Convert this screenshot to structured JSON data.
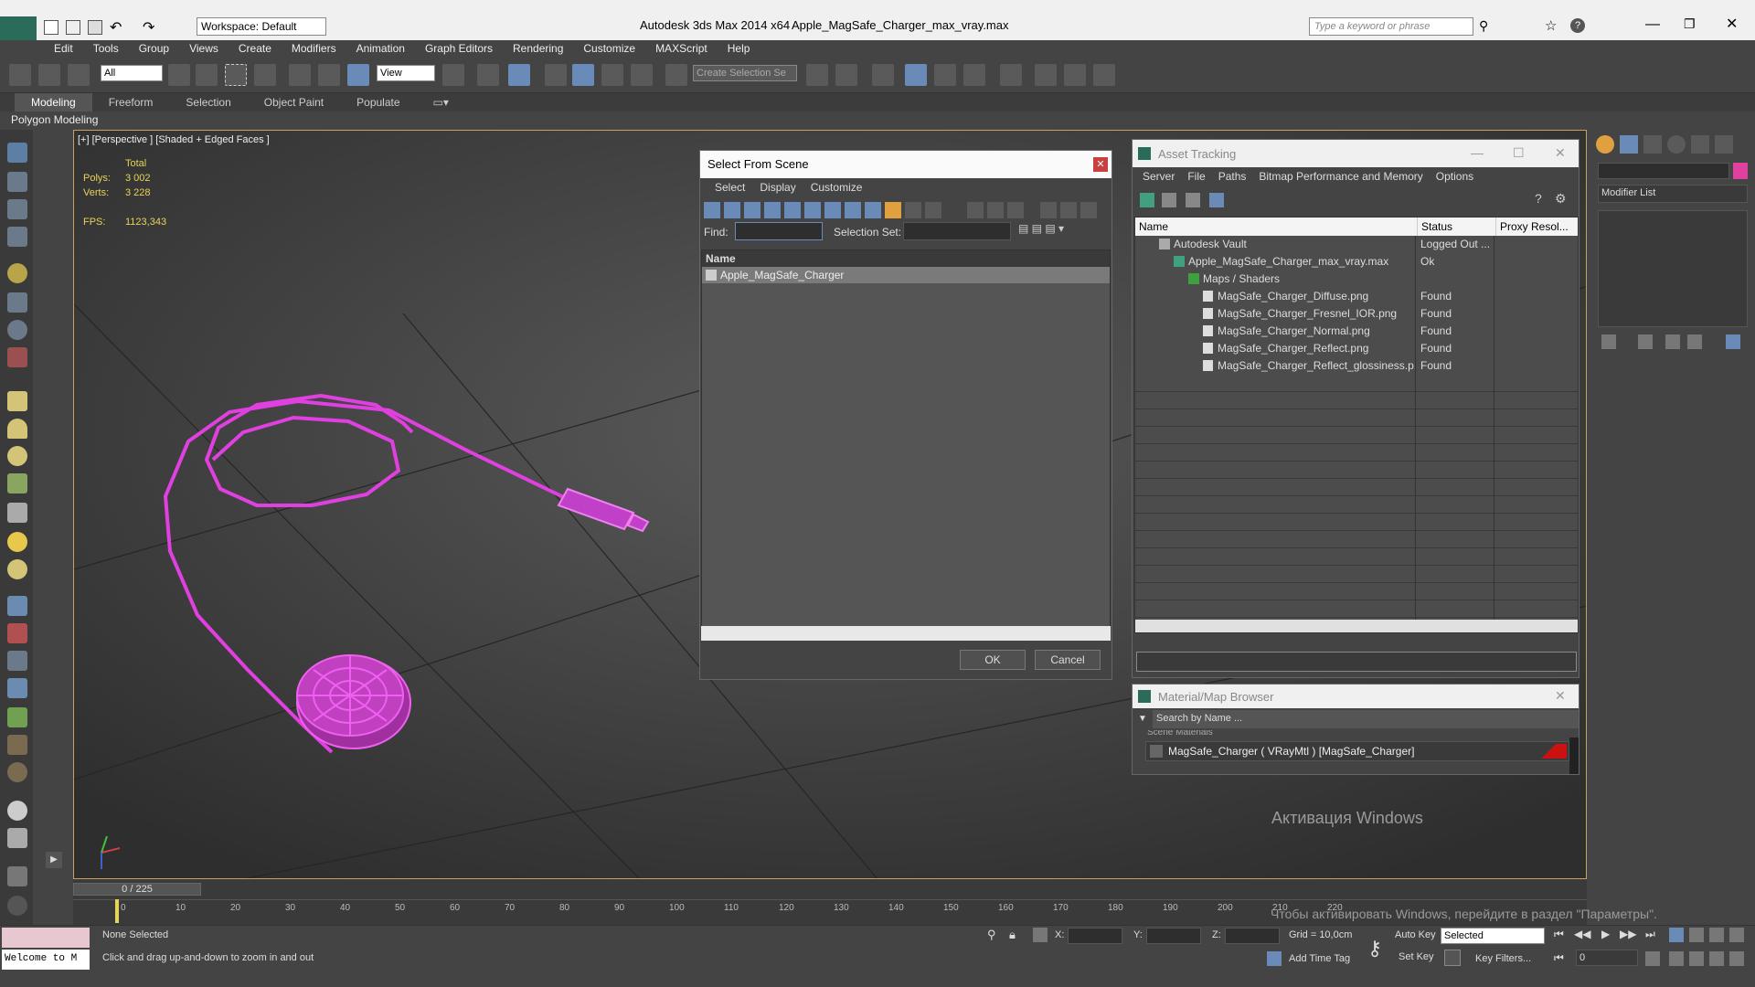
{
  "titlebar": {
    "workspace": "Workspace: Default",
    "app": "Autodesk 3ds Max  2014 x64",
    "file": "Apple_MagSafe_Charger_max_vray.max",
    "search_placeholder": "Type a keyword or phrase"
  },
  "menu": [
    "Edit",
    "Tools",
    "Group",
    "Views",
    "Create",
    "Modifiers",
    "Animation",
    "Graph Editors",
    "Rendering",
    "Customize",
    "MAXScript",
    "Help"
  ],
  "toolbar": {
    "filter_select": "All",
    "ref_coord": "View",
    "selection_set_placeholder": "Create Selection Se"
  },
  "ribbon": {
    "tabs": [
      "Modeling",
      "Freeform",
      "Selection",
      "Object Paint",
      "Populate"
    ],
    "sub": "Polygon Modeling"
  },
  "viewport": {
    "label": "[+] [Perspective ] [Shaded + Edged Faces ]",
    "stats_header": "Total",
    "polys_label": "Polys:",
    "polys_value": "3 002",
    "verts_label": "Verts:",
    "verts_value": "3 228",
    "fps_label": "FPS:",
    "fps_value": "1123,343"
  },
  "select_from_scene": {
    "title": "Select From Scene",
    "menus": [
      "Select",
      "Display",
      "Customize"
    ],
    "find_label": "Find:",
    "selection_set_label": "Selection Set:",
    "column_name": "Name",
    "items": [
      "Apple_MagSafe_Charger"
    ],
    "ok": "OK",
    "cancel": "Cancel"
  },
  "asset_tracking": {
    "title": "Asset Tracking",
    "menus": [
      "Server",
      "File",
      "Paths",
      "Bitmap Performance and Memory",
      "Options"
    ],
    "columns": [
      "Name",
      "Status",
      "Proxy Resol..."
    ],
    "rows": [
      {
        "name": "Autodesk Vault",
        "status": "Logged Out ..."
      },
      {
        "name": "Apple_MagSafe_Charger_max_vray.max",
        "status": "Ok"
      },
      {
        "name": "Maps / Shaders",
        "status": ""
      },
      {
        "name": "MagSafe_Charger_Diffuse.png",
        "status": "Found"
      },
      {
        "name": "MagSafe_Charger_Fresnel_IOR.png",
        "status": "Found"
      },
      {
        "name": "MagSafe_Charger_Normal.png",
        "status": "Found"
      },
      {
        "name": "MagSafe_Charger_Reflect.png",
        "status": "Found"
      },
      {
        "name": "MagSafe_Charger_Reflect_glossiness.p...",
        "status": "Found"
      }
    ]
  },
  "material_browser": {
    "title": "Material/Map Browser",
    "search_placeholder": "Search by Name ...",
    "group": "Scene Materials",
    "item": "MagSafe_Charger  ( VRayMtl ) [MagSafe_Charger]"
  },
  "command_panel": {
    "modifier_list": "Modifier List"
  },
  "timeline": {
    "frame": "0 / 225",
    "ticks": [
      "0",
      "10",
      "20",
      "30",
      "40",
      "50",
      "60",
      "70",
      "80",
      "90",
      "100",
      "110",
      "120",
      "130",
      "140",
      "150",
      "160",
      "170",
      "180",
      "190",
      "200",
      "210",
      "220"
    ]
  },
  "status": {
    "maxscript": "Welcome to M",
    "selection": "None Selected",
    "prompt": "Click and drag up-and-down to zoom in and out",
    "x": "X:",
    "y": "Y:",
    "z": "Z:",
    "grid": "Grid = 10,0cm",
    "add_time_tag": "Add Time Tag",
    "auto_key": "Auto Key",
    "set_key": "Set Key",
    "key_mode": "Selected",
    "key_filters": "Key Filters...",
    "frame_value": "0"
  },
  "watermark": {
    "line1": "Активация Windows",
    "line2": "Чтобы активировать Windows, перейдите в раздел \"Параметры\"."
  },
  "colors": {
    "accent": "#c7a15d",
    "wire": "#e040e0",
    "mat_swatch": "#cc1111"
  }
}
